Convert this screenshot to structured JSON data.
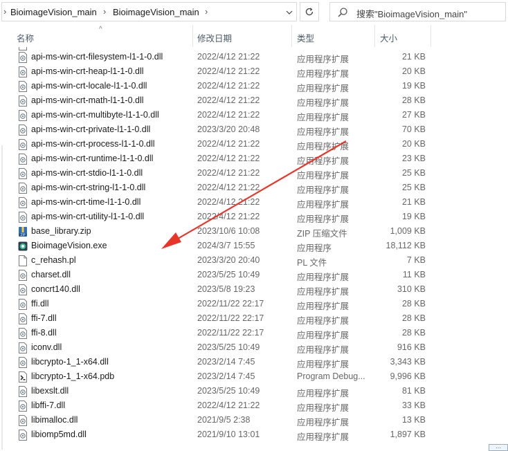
{
  "address": {
    "breadcrumbs": [
      "BioimageVision_main",
      "BioimageVision_main"
    ],
    "search_placeholder": "搜索\"BioimageVision_main\""
  },
  "columns": {
    "name": "名称",
    "date": "修改日期",
    "type": "类型",
    "size": "大小"
  },
  "files": [
    {
      "name": "api-ms-win-crt-filesystem-l1-1-0.dll",
      "date": "2022/4/12 21:22",
      "type": "应用程序扩展",
      "size": "21 KB",
      "icon": "dll-icon"
    },
    {
      "name": "api-ms-win-crt-heap-l1-1-0.dll",
      "date": "2022/4/12 21:22",
      "type": "应用程序扩展",
      "size": "20 KB",
      "icon": "dll-icon"
    },
    {
      "name": "api-ms-win-crt-locale-l1-1-0.dll",
      "date": "2022/4/12 21:22",
      "type": "应用程序扩展",
      "size": "19 KB",
      "icon": "dll-icon"
    },
    {
      "name": "api-ms-win-crt-math-l1-1-0.dll",
      "date": "2022/4/12 21:22",
      "type": "应用程序扩展",
      "size": "28 KB",
      "icon": "dll-icon"
    },
    {
      "name": "api-ms-win-crt-multibyte-l1-1-0.dll",
      "date": "2022/4/12 21:22",
      "type": "应用程序扩展",
      "size": "27 KB",
      "icon": "dll-icon"
    },
    {
      "name": "api-ms-win-crt-private-l1-1-0.dll",
      "date": "2023/3/20 20:48",
      "type": "应用程序扩展",
      "size": "70 KB",
      "icon": "dll-icon"
    },
    {
      "name": "api-ms-win-crt-process-l1-1-0.dll",
      "date": "2022/4/12 21:22",
      "type": "应用程序扩展",
      "size": "20 KB",
      "icon": "dll-icon"
    },
    {
      "name": "api-ms-win-crt-runtime-l1-1-0.dll",
      "date": "2022/4/12 21:22",
      "type": "应用程序扩展",
      "size": "23 KB",
      "icon": "dll-icon"
    },
    {
      "name": "api-ms-win-crt-stdio-l1-1-0.dll",
      "date": "2022/4/12 21:22",
      "type": "应用程序扩展",
      "size": "25 KB",
      "icon": "dll-icon"
    },
    {
      "name": "api-ms-win-crt-string-l1-1-0.dll",
      "date": "2022/4/12 21:22",
      "type": "应用程序扩展",
      "size": "25 KB",
      "icon": "dll-icon"
    },
    {
      "name": "api-ms-win-crt-time-l1-1-0.dll",
      "date": "2022/4/12 21:22",
      "type": "应用程序扩展",
      "size": "21 KB",
      "icon": "dll-icon"
    },
    {
      "name": "api-ms-win-crt-utility-l1-1-0.dll",
      "date": "2022/4/12 21:22",
      "type": "应用程序扩展",
      "size": "19 KB",
      "icon": "dll-icon"
    },
    {
      "name": "base_library.zip",
      "date": "2023/10/6 10:08",
      "type": "ZIP 压缩文件",
      "size": "1,009 KB",
      "icon": "zip-icon"
    },
    {
      "name": "BioimageVision.exe",
      "date": "2024/3/7 15:55",
      "type": "应用程序",
      "size": "18,112 KB",
      "icon": "exe-icon"
    },
    {
      "name": "c_rehash.pl",
      "date": "2023/3/20 20:40",
      "type": "PL 文件",
      "size": "7 KB",
      "icon": "blank-file-icon"
    },
    {
      "name": "charset.dll",
      "date": "2023/5/25 10:49",
      "type": "应用程序扩展",
      "size": "11 KB",
      "icon": "dll-icon"
    },
    {
      "name": "concrt140.dll",
      "date": "2023/5/8 19:23",
      "type": "应用程序扩展",
      "size": "310 KB",
      "icon": "dll-icon"
    },
    {
      "name": "ffi.dll",
      "date": "2022/11/22 22:17",
      "type": "应用程序扩展",
      "size": "28 KB",
      "icon": "dll-icon"
    },
    {
      "name": "ffi-7.dll",
      "date": "2022/11/22 22:17",
      "type": "应用程序扩展",
      "size": "28 KB",
      "icon": "dll-icon"
    },
    {
      "name": "ffi-8.dll",
      "date": "2022/11/22 22:17",
      "type": "应用程序扩展",
      "size": "28 KB",
      "icon": "dll-icon"
    },
    {
      "name": "iconv.dll",
      "date": "2023/5/25 10:49",
      "type": "应用程序扩展",
      "size": "916 KB",
      "icon": "dll-icon"
    },
    {
      "name": "libcrypto-1_1-x64.dll",
      "date": "2023/2/14 7:45",
      "type": "应用程序扩展",
      "size": "3,343 KB",
      "icon": "dll-icon"
    },
    {
      "name": "libcrypto-1_1-x64.pdb",
      "date": "2023/2/14 7:45",
      "type": "Program Debug...",
      "size": "9,996 KB",
      "icon": "pdb-icon"
    },
    {
      "name": "libexslt.dll",
      "date": "2023/5/25 10:49",
      "type": "应用程序扩展",
      "size": "81 KB",
      "icon": "dll-icon"
    },
    {
      "name": "libffi-7.dll",
      "date": "2022/4/12 21:22",
      "type": "应用程序扩展",
      "size": "33 KB",
      "icon": "dll-icon"
    },
    {
      "name": "libimalloc.dll",
      "date": "2021/9/5 2:38",
      "type": "应用程序扩展",
      "size": "13 KB",
      "icon": "dll-icon"
    },
    {
      "name": "libiomp5md.dll",
      "date": "2021/9/10 13:01",
      "type": "应用程序扩展",
      "size": "1,897 KB",
      "icon": "dll-icon"
    }
  ],
  "annotation": {
    "color": "#e8352a"
  }
}
